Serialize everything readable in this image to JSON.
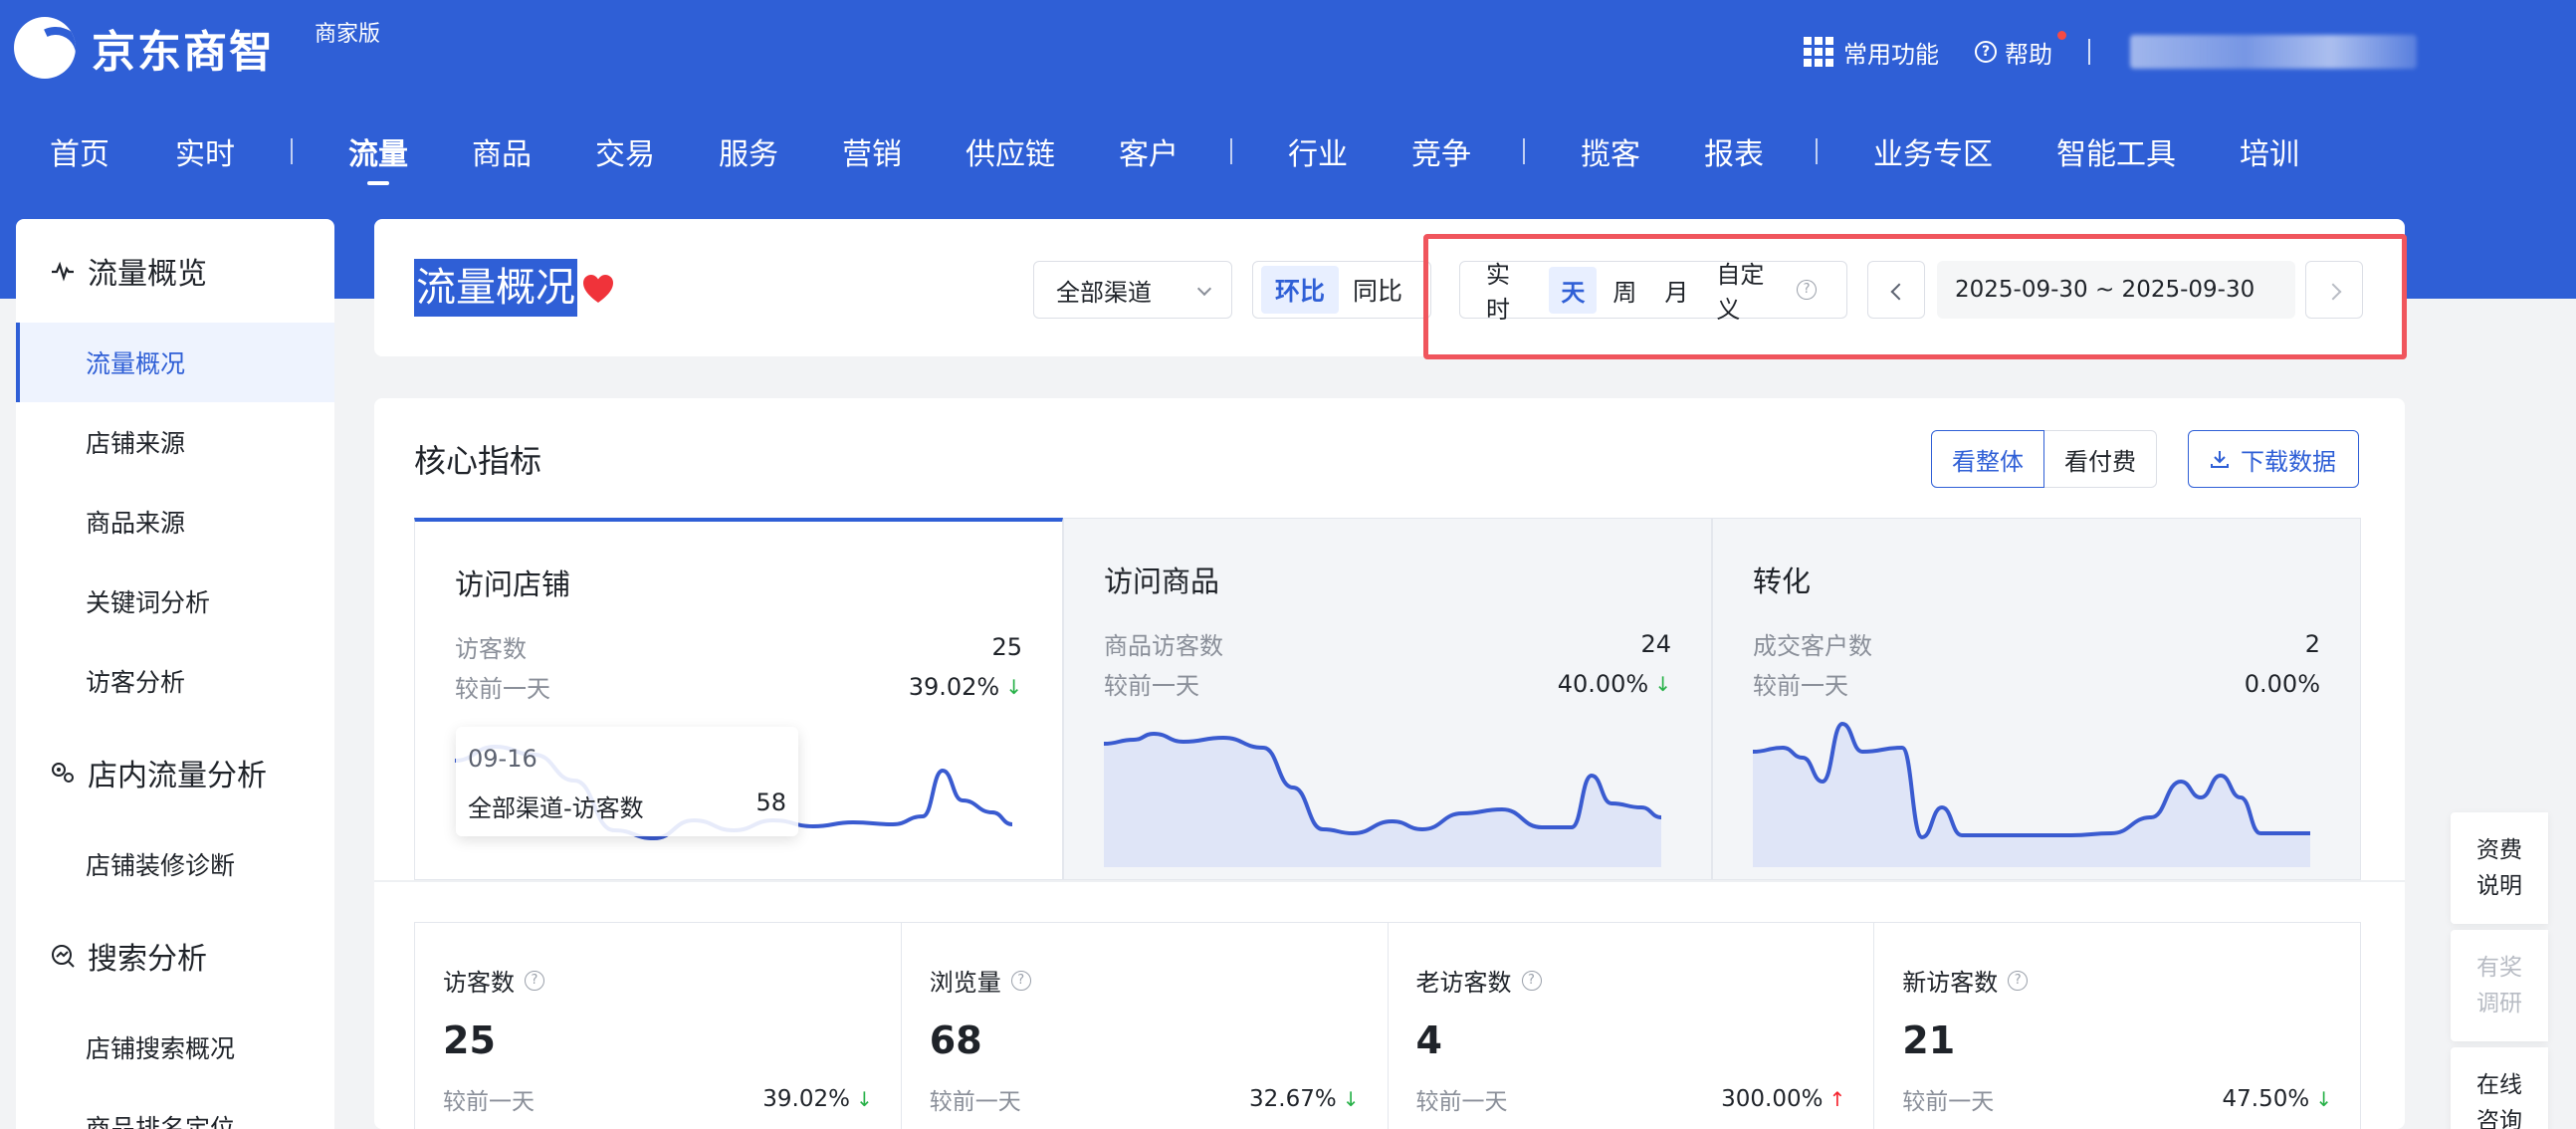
{
  "header": {
    "logo_text": "京东商智",
    "logo_sub": "商家版",
    "actions": {
      "common": "常用功能",
      "help": "帮助"
    }
  },
  "nav": [
    "首页",
    "实时",
    "流量",
    "商品",
    "交易",
    "服务",
    "营销",
    "供应链",
    "客户",
    "行业",
    "竞争",
    "揽客",
    "报表",
    "业务专区",
    "智能工具",
    "培训"
  ],
  "sidebar": {
    "group1": "流量概览",
    "group1_items": [
      "流量概况",
      "店铺来源",
      "商品来源",
      "关键词分析",
      "访客分析"
    ],
    "group2": "店内流量分析",
    "group2_items": [
      "店铺装修诊断"
    ],
    "group3": "搜索分析",
    "group3_items": [
      "店铺搜索概况",
      "商品排名定位"
    ]
  },
  "page": {
    "title": "流量概况",
    "channel": "全部渠道",
    "compare": {
      "a": "环比",
      "b": "同比"
    },
    "periods": [
      "实时",
      "天",
      "周",
      "月",
      "自定义"
    ],
    "date_range": "2025-09-30 ~ 2025-09-30"
  },
  "core": {
    "title": "核心指标",
    "view_all": "看整体",
    "view_paid": "看付费",
    "download": "下载数据",
    "tabs": [
      {
        "title": "访问店铺",
        "metric": "访客数",
        "value": "25",
        "cmp_label": "较前一天",
        "cmp_value": "39.02%",
        "trend": "down"
      },
      {
        "title": "访问商品",
        "metric": "商品访客数",
        "value": "24",
        "cmp_label": "较前一天",
        "cmp_value": "40.00%",
        "trend": "down"
      },
      {
        "title": "转化",
        "metric": "成交客户数",
        "value": "2",
        "cmp_label": "较前一天",
        "cmp_value": "0.00%",
        "trend": "none"
      }
    ],
    "tooltip": {
      "date": "09-16",
      "label": "全部渠道-访客数",
      "value": "58"
    },
    "stats": [
      {
        "label": "访客数",
        "value": "25",
        "cmp_label": "较前一天",
        "cmp_value": "39.02%",
        "trend": "down"
      },
      {
        "label": "浏览量",
        "value": "68",
        "cmp_label": "较前一天",
        "cmp_value": "32.67%",
        "trend": "down"
      },
      {
        "label": "老访客数",
        "value": "4",
        "cmp_label": "较前一天",
        "cmp_value": "300.00%",
        "trend": "up"
      },
      {
        "label": "新访客数",
        "value": "21",
        "cmp_label": "较前一天",
        "cmp_value": "47.50%",
        "trend": "down"
      }
    ]
  },
  "float_tools": [
    {
      "line1": "资费",
      "line2": "说明"
    },
    {
      "line1": "有奖",
      "line2": "调研"
    },
    {
      "line1": "在线",
      "line2": "咨询"
    }
  ],
  "colors": {
    "brand": "#2f5fd6",
    "down": "#27b148",
    "up": "#f5222d",
    "highlight": "#f0555d"
  }
}
